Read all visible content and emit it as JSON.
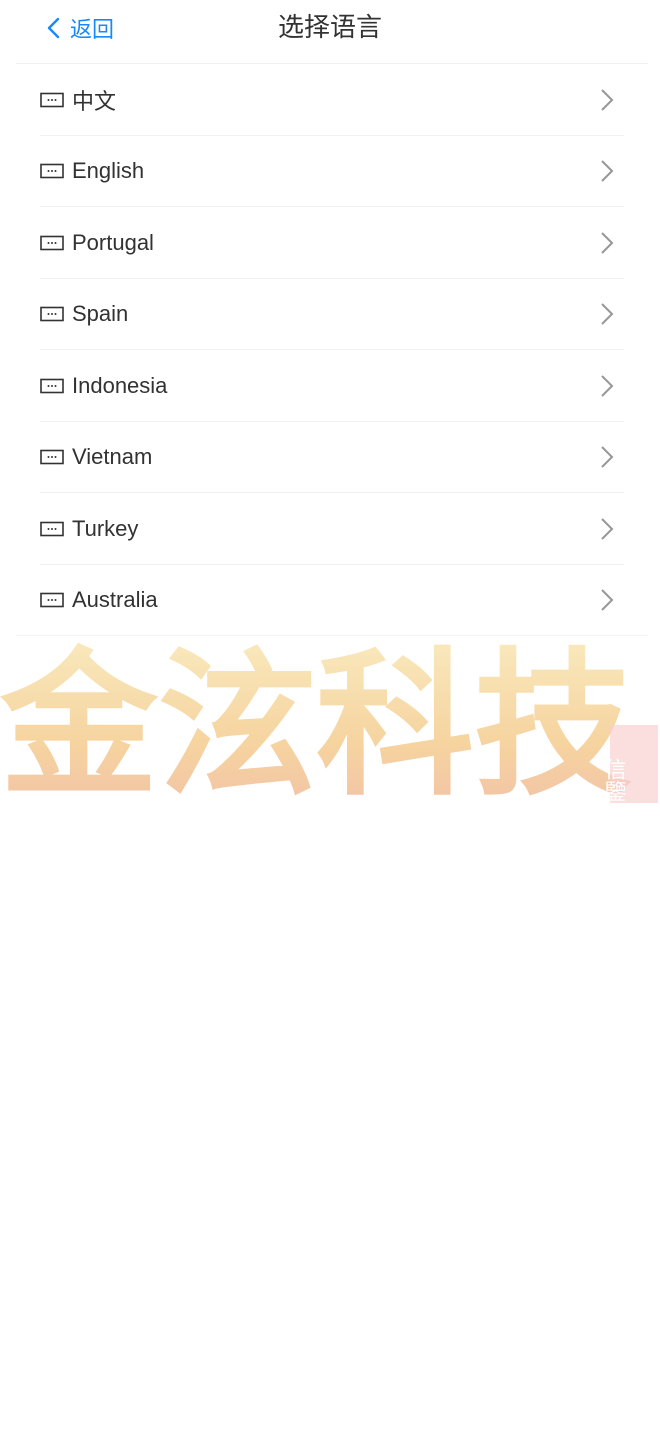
{
  "nav": {
    "back_label": "返回",
    "title": "选择语言"
  },
  "languages": [
    {
      "label": "中文",
      "icon": "language-flag-icon"
    },
    {
      "label": "English",
      "icon": "language-flag-icon"
    },
    {
      "label": "Portugal",
      "icon": "language-flag-icon"
    },
    {
      "label": "Spain",
      "icon": "language-flag-icon"
    },
    {
      "label": "Indonesia",
      "icon": "language-flag-icon"
    },
    {
      "label": "Vietnam",
      "icon": "language-flag-icon"
    },
    {
      "label": "Turkey",
      "icon": "language-flag-icon"
    },
    {
      "label": "Australia",
      "icon": "language-flag-icon"
    }
  ],
  "watermark": {
    "text": "金泫科技",
    "seal_text": "信鑒"
  },
  "colors": {
    "accent": "#1989fa",
    "text": "#323233",
    "arrow": "#969799",
    "watermark": "#f0b44a"
  }
}
